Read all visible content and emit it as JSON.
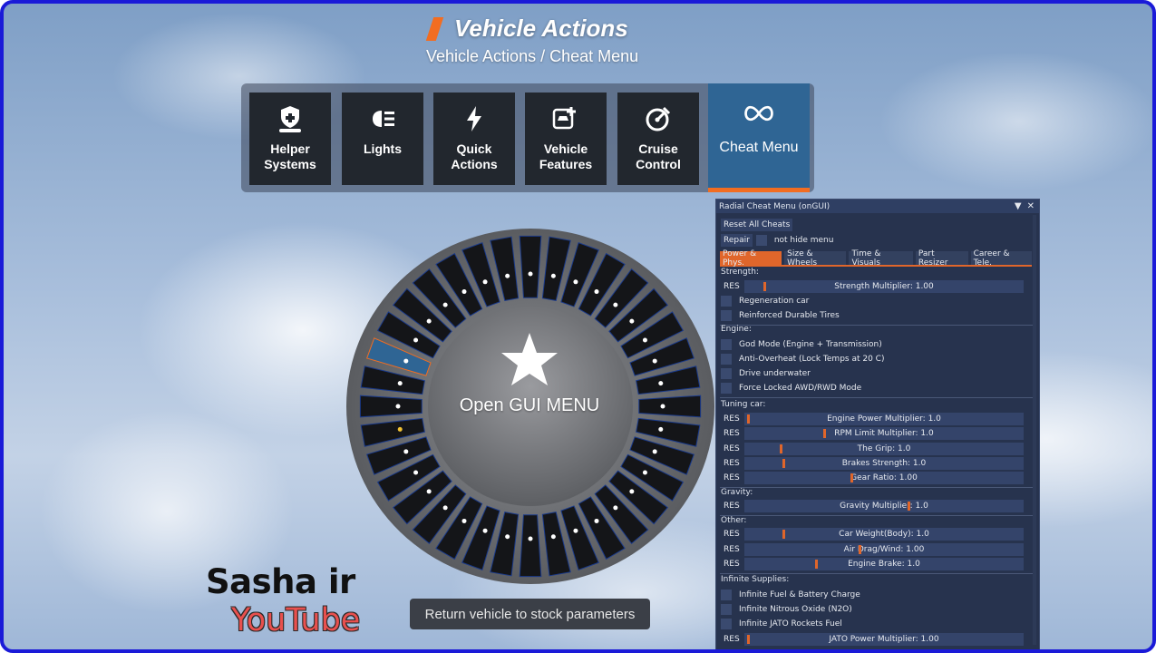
{
  "header": {
    "title": "Vehicle Actions",
    "subtitle": "Vehicle Actions / Cheat Menu"
  },
  "tabs": [
    {
      "label": "Helper\nSystems",
      "icon": "shield-hand-icon"
    },
    {
      "label": "Lights",
      "icon": "headlight-icon"
    },
    {
      "label": "Quick\nActions",
      "icon": "lightning-icon"
    },
    {
      "label": "Vehicle\nFeatures",
      "icon": "car-plus-icon"
    },
    {
      "label": "Cruise\nControl",
      "icon": "speedometer-icon"
    },
    {
      "label": "Cheat Menu",
      "icon": "infinity-icon",
      "active": true
    }
  ],
  "radial": {
    "center_label": "Open GUI MENU",
    "center_icon": "star-icon",
    "slot_count": 36,
    "selected_slot": 29
  },
  "return_button": "Return vehicle to stock parameters",
  "brand": {
    "line1": "Sasha ir",
    "line2": "YouTube"
  },
  "panel": {
    "title": "Radial Cheat Menu (onGUI)",
    "reset_all": "Reset All Cheats",
    "repair": "Repair",
    "not_hide": "not hide menu",
    "tabs": [
      "Power & Phys.",
      "Size & Wheels",
      "Time & Visuals",
      "Part Resizer",
      "Career & Tele."
    ],
    "res": "RES",
    "sections": {
      "strength": "Strength:",
      "engine": "Engine:",
      "tuning": "Tuning car:",
      "gravity": "Gravity:",
      "other": "Other:",
      "supplies": "Infinite Supplies:"
    },
    "strength_slider": {
      "label": "Strength Multiplier: 1.00",
      "level": 0.07
    },
    "strength_checks": [
      "Regeneration car",
      "Reinforced Durable Tires"
    ],
    "engine_checks": [
      "God Mode (Engine + Transmission)",
      "Anti-Overheat (Lock Temps at 20 C)",
      "Drive underwater",
      "Force Locked AWD/RWD Mode"
    ],
    "tuning_sliders": [
      {
        "label": "Engine Power Multiplier: 1.0",
        "level": 0.01
      },
      {
        "label": "RPM Limit Multiplier: 1.0",
        "level": 0.29
      },
      {
        "label": "The Grip: 1.0",
        "level": 0.13
      },
      {
        "label": "Brakes Strength: 1.0",
        "level": 0.14
      },
      {
        "label": "Gear Ratio: 1.00",
        "level": 0.39
      }
    ],
    "gravity_slider": {
      "label": "Gravity Multiplier: 1.0",
      "level": 0.6
    },
    "other_sliders": [
      {
        "label": "Car Weight(Body): 1.0",
        "level": 0.14
      },
      {
        "label": "Air Drag/Wind: 1.00",
        "level": 0.42
      },
      {
        "label": "Engine Brake: 1.0",
        "level": 0.26
      }
    ],
    "supply_checks": [
      "Infinite Fuel & Battery Charge",
      "Infinite Nitrous Oxide (N2O)",
      "Infinite JATO Rockets Fuel"
    ],
    "jato_slider": {
      "label": "JATO Power Multiplier: 1.00",
      "level": 0.01
    }
  }
}
